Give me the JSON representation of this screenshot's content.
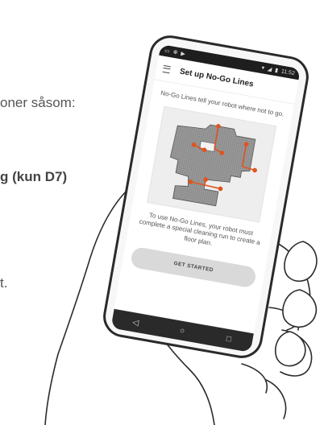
{
  "background_text": {
    "line1": "oner såsom:",
    "line2": "g (kun D7)",
    "line3": "t."
  },
  "phone": {
    "statusbar": {
      "time": "11:52"
    },
    "appbar": {
      "title": "Set up No-Go Lines"
    },
    "intro": "No-Go Lines tell your robot where not to go.",
    "explanation": "To use No-Go Lines, your robot must complete a special cleaning run to create a floor plan.",
    "cta_label": "GET STARTED",
    "navbar": {
      "back_icon": "◁",
      "home_icon": "○",
      "recents_icon": "□"
    }
  },
  "colors": {
    "accent": "#e0531f",
    "floorplan": "#8a8a8a",
    "button": "#d9d9d9"
  },
  "icons": [
    "menu-icon",
    "back-icon",
    "home-icon",
    "recents-icon",
    "wifi-icon",
    "battery-icon",
    "signal-icon"
  ]
}
